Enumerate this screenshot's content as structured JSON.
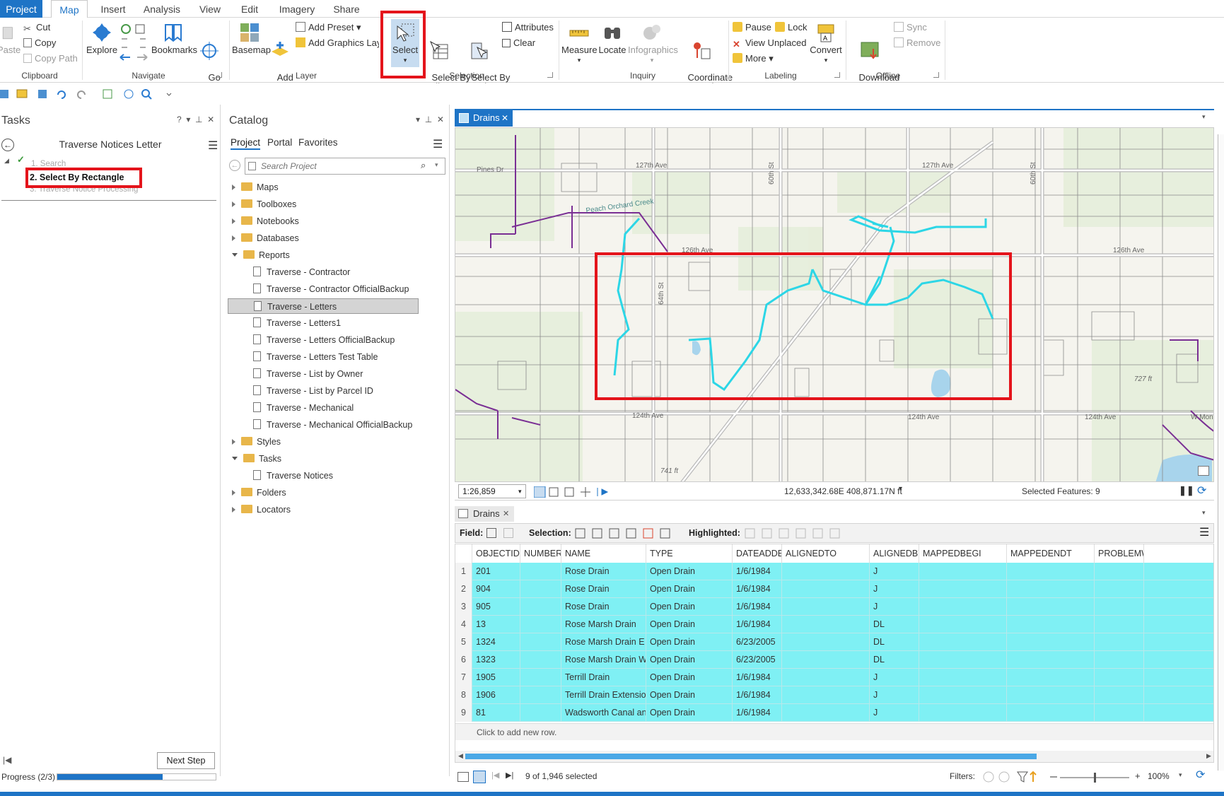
{
  "tabs": [
    "Project",
    "Map",
    "Insert",
    "Analysis",
    "View",
    "Edit",
    "Imagery",
    "Share"
  ],
  "ribbon": {
    "clipboard": {
      "paste": "Paste",
      "cut": "Cut",
      "copy": "Copy",
      "copy_path": "Copy Path",
      "group": "Clipboard"
    },
    "navigate": {
      "explore": "Explore",
      "bookmarks": "Bookmarks",
      "goto": "Go\nTo XY",
      "group": "Navigate"
    },
    "layer": {
      "basemap": "Basemap",
      "add_data": "Add\nData",
      "add_preset": "Add Preset",
      "add_graphics": "Add Graphics Layer",
      "group": "Layer"
    },
    "selection": {
      "select": "Select",
      "by_attr": "Select By\nAttributes",
      "by_loc": "Select By\nLocation",
      "attributes": "Attributes",
      "clear": "Clear",
      "group": "Selection"
    },
    "inquiry": {
      "measure": "Measure",
      "locate": "Locate",
      "infographics": "Infographics",
      "coord": "Coordinate\nConversion",
      "group": "Inquiry"
    },
    "labeling": {
      "pause": "Pause",
      "lock": "Lock",
      "view_unplaced": "View Unplaced",
      "more": "More",
      "convert": "Convert",
      "group": "Labeling"
    },
    "offline": {
      "download": "Download\nMap",
      "sync": "Sync",
      "remove": "Remove",
      "group": "Offline"
    }
  },
  "tasks": {
    "pane_title": "Tasks",
    "task_name": "Traverse Notices Letter",
    "steps": [
      "1.  Search",
      "2.  Select By Rectangle",
      "3.  Traverse Notice Processing"
    ],
    "next_step": "Next Step",
    "progress_label": "Progress (2/3)",
    "progress_fraction": 0.667
  },
  "catalog": {
    "pane_title": "Catalog",
    "tabs": [
      "Project",
      "Portal",
      "Favorites"
    ],
    "search_placeholder": "Search Project",
    "items": [
      {
        "label": "Maps",
        "type": "folder",
        "expanded": false,
        "level": 0
      },
      {
        "label": "Toolboxes",
        "type": "folder",
        "expanded": false,
        "level": 0
      },
      {
        "label": "Notebooks",
        "type": "folder",
        "expanded": false,
        "level": 0
      },
      {
        "label": "Databases",
        "type": "folder",
        "expanded": false,
        "level": 0
      },
      {
        "label": "Reports",
        "type": "folder",
        "expanded": true,
        "level": 0
      },
      {
        "label": "Traverse - Contractor",
        "type": "doc",
        "level": 1
      },
      {
        "label": "Traverse - Contractor OfficialBackup",
        "type": "doc",
        "level": 1
      },
      {
        "label": "Traverse - Letters",
        "type": "doc",
        "level": 1,
        "selected": true
      },
      {
        "label": "Traverse - Letters1",
        "type": "doc",
        "level": 1
      },
      {
        "label": "Traverse - Letters OfficialBackup",
        "type": "doc",
        "level": 1
      },
      {
        "label": "Traverse - Letters Test Table",
        "type": "doc",
        "level": 1
      },
      {
        "label": "Traverse - List by Owner",
        "type": "doc",
        "level": 1
      },
      {
        "label": "Traverse - List by Parcel ID",
        "type": "doc",
        "level": 1
      },
      {
        "label": "Traverse - Mechanical",
        "type": "doc",
        "level": 1
      },
      {
        "label": "Traverse - Mechanical OfficialBackup",
        "type": "doc",
        "level": 1
      },
      {
        "label": "Styles",
        "type": "folder",
        "expanded": false,
        "level": 0
      },
      {
        "label": "Tasks",
        "type": "folder",
        "expanded": true,
        "level": 0
      },
      {
        "label": "Traverse Notices",
        "type": "doc",
        "level": 1
      },
      {
        "label": "Folders",
        "type": "folder",
        "expanded": false,
        "level": 0
      },
      {
        "label": "Locators",
        "type": "folder",
        "expanded": false,
        "level": 0
      }
    ]
  },
  "map": {
    "tab_label": "Drains",
    "scale": "1:26,859",
    "coordinates": "12,633,342.68E 408,871.17N ft",
    "selected_features": "Selected Features: 9",
    "labels": {
      "pines_dr": "Pines Dr",
      "ave_127a": "127th Ave",
      "ave_127b": "127th Ave",
      "peach": "Peach Orchard Creek",
      "ave_126a": "126th Ave",
      "ave_126b": "126th Ave",
      "ave_124a": "124th Ave",
      "ave_124b": "124th Ave",
      "ave_124c": "124th Ave",
      "st_64": "64th St",
      "st_60": "60th St",
      "st_60b": "60th St",
      "ft_727": "727 ft",
      "ft_741": "741 ft",
      "ave_w": "W Mon"
    }
  },
  "table": {
    "tab_label": "Drains",
    "field_label": "Field:",
    "selection_label": "Selection:",
    "highlighted_label": "Highlighted:",
    "columns": [
      "OBJECTID *",
      "NUMBER",
      "NAME",
      "TYPE",
      "DATEADDED",
      "ALIGNEDTO",
      "ALIGNEDBY",
      "MAPPEDBEGI",
      "MAPPEDENDT",
      "PROBLEMWIT"
    ],
    "rows": [
      [
        "1",
        "201",
        "",
        "Rose Drain",
        "Open Drain",
        "1/6/1984",
        "",
        "J",
        "",
        "",
        ""
      ],
      [
        "2",
        "904",
        "",
        "Rose Drain",
        "Open Drain",
        "1/6/1984",
        "",
        "J",
        "",
        "",
        ""
      ],
      [
        "3",
        "905",
        "",
        "Rose Drain",
        "Open Drain",
        "1/6/1984",
        "",
        "J",
        "",
        "",
        ""
      ],
      [
        "4",
        "13",
        "",
        "Rose Marsh Drain",
        "Open Drain",
        "1/6/1984",
        "",
        "DL",
        "",
        "",
        ""
      ],
      [
        "5",
        "1324",
        "",
        "Rose Marsh Drain E Br",
        "Open Drain",
        "6/23/2005",
        "",
        "DL",
        "",
        "",
        ""
      ],
      [
        "6",
        "1323",
        "",
        "Rose Marsh Drain W Br",
        "Open Drain",
        "6/23/2005",
        "",
        "DL",
        "",
        "",
        ""
      ],
      [
        "7",
        "1905",
        "",
        "Terrill Drain",
        "Open Drain",
        "1/6/1984",
        "",
        "J",
        "",
        "",
        ""
      ],
      [
        "8",
        "1906",
        "",
        "Terrill Drain Extension",
        "Open Drain",
        "1/6/1984",
        "",
        "J",
        "",
        "",
        ""
      ],
      [
        "9",
        "81",
        "",
        "Wadsworth Canal an...",
        "Open Drain",
        "1/6/1984",
        "",
        "J",
        "",
        "",
        ""
      ]
    ],
    "add_row": "Click to add new row.",
    "selected_count": "9 of 1,946 selected",
    "filters_label": "Filters:",
    "zoom": "100%"
  }
}
